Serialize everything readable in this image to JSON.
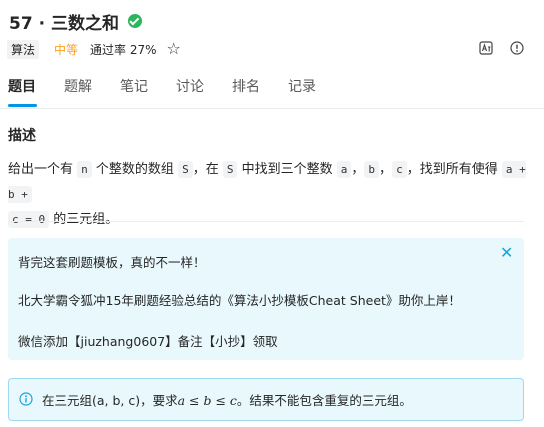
{
  "problem": {
    "title": "57 · 三数之和",
    "tag": "算法",
    "difficulty": "中等",
    "pass_rate": "通过率 27%"
  },
  "tabs": [
    {
      "label": "题目",
      "active": true
    },
    {
      "label": "题解",
      "active": false
    },
    {
      "label": "笔记",
      "active": false
    },
    {
      "label": "讨论",
      "active": false
    },
    {
      "label": "排名",
      "active": false
    },
    {
      "label": "记录",
      "active": false
    }
  ],
  "description": {
    "heading": "描述",
    "t1": "给出一个有",
    "c1": "n",
    "t2": "个整数的数组",
    "c2": "S",
    "t3": "，在",
    "c3": "S",
    "t4": "中找到三个整数",
    "c4": "a",
    "t5": "，",
    "c5": "b",
    "t6": "，",
    "c6": "c",
    "t7": "，找到所有使得",
    "c7": "a + b +",
    "c8": "c = 0",
    "t8": "的三元组。"
  },
  "promo": {
    "line1": "背完这套刷题模板，真的不一样！",
    "line2": "北大学霸令狐冲15年刷题经验总结的《算法小抄模板Cheat Sheet》助你上岸！",
    "line3": "微信添加【jiuzhang0607】备注【小抄】领取"
  },
  "info": {
    "prefix": "在三元组(a, b, c)，要求",
    "math": "a ≤ b ≤ c",
    "suffix": "。结果不能包含重复的三元组。"
  },
  "colors": {
    "accent": "#0096e6",
    "difficulty": "#ff9f21",
    "solved": "#2db55d",
    "promo_bg": "#e8f8fd"
  },
  "icons": {
    "solved": "check-circle-icon",
    "favorite": "star-outline-icon",
    "translate": "translate-icon",
    "feedback": "exclamation-circle-icon",
    "close": "close-icon",
    "info": "info-circle-icon"
  }
}
